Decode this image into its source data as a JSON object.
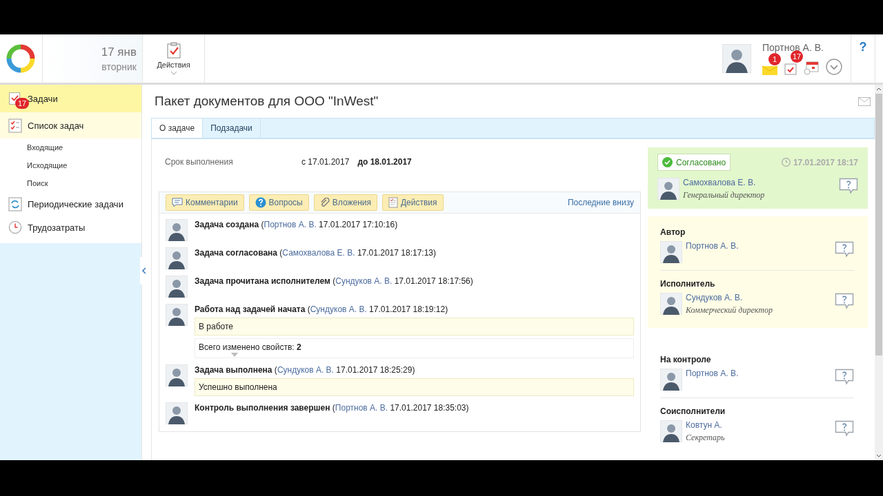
{
  "header": {
    "date": "17 янв",
    "weekday": "вторник",
    "actions_label": "Действия",
    "user_name": "Портнов А. В.",
    "mail_badge": "1",
    "tasks_badge": "17",
    "help": "?"
  },
  "sidebar": {
    "items": [
      {
        "label": "Задачи",
        "selected": true,
        "badge": "17"
      },
      {
        "label": "Список задач",
        "selected": false,
        "expanded": true,
        "children": [
          {
            "label": "Входящие"
          },
          {
            "label": "Исходящие"
          },
          {
            "label": "Поиск"
          }
        ]
      },
      {
        "label": "Периодические задачи",
        "selected": false
      },
      {
        "label": "Трудозатраты",
        "selected": false
      }
    ]
  },
  "task": {
    "title": "Пакет документов для ООО \"InWest\"",
    "tabs": [
      {
        "label": "О задаче",
        "selected": true
      },
      {
        "label": "Подзадачи",
        "selected": false
      }
    ],
    "deadline": {
      "label": "Срок выполнения",
      "from": "с 17.01.2017",
      "to": "до 18.01.2017"
    },
    "feed": {
      "filters": [
        {
          "kind": "comments",
          "label": "Комментарии"
        },
        {
          "kind": "questions",
          "label": "Вопросы"
        },
        {
          "kind": "attachments",
          "label": "Вложения"
        },
        {
          "kind": "actions",
          "label": "Действия"
        }
      ],
      "order_link": "Последние внизу",
      "events": [
        {
          "title": "Задача создана",
          "open": "(",
          "author": "Портнов А. В.",
          "time": "17.01.2017 17:10:16)"
        },
        {
          "title": "Задача согласована",
          "open": "(",
          "author": "Самохвалова Е. В.",
          "time": "17.01.2017 18:17:13)"
        },
        {
          "title": "Задача прочитана исполнителем",
          "open": "(",
          "author": "Сундуков А. В.",
          "time": "17.01.2017 18:17:56)"
        },
        {
          "title": "Работа над задачей начата",
          "open": "(",
          "author": "Сундуков А. В.",
          "time": "17.01.2017 18:19:12)",
          "note": "В работе",
          "summary": "Всего изменено свойств: **2**"
        },
        {
          "title": "Задача выполнена",
          "open": "(",
          "author": "Сундуков А. В.",
          "time": "17.01.2017 18:25:29)",
          "note": "Успешно выполнена"
        },
        {
          "title": "Контроль выполнения завершен",
          "open": "(",
          "author": "Портнов А. В.",
          "time": "17.01.2017 18:35:03)"
        }
      ]
    }
  },
  "approval": {
    "status": "Согласовано",
    "time": "17.01.2017 18:17",
    "name": "Самохвалова Е. В.",
    "role": "Генеральный директор"
  },
  "participant_groups": [
    {
      "highlighted": true,
      "sections": [
        {
          "heading": "Автор",
          "name": "Портнов А. В."
        },
        {
          "heading": "Исполнитель",
          "name": "Сундуков А. В.",
          "role": "Коммерческий директор"
        }
      ]
    },
    {
      "highlighted": false,
      "sections": [
        {
          "heading": "На контроле",
          "name": "Портнов А. В."
        },
        {
          "heading": "Соисполнители",
          "name": "Ковтун А.",
          "role": "Секретарь"
        }
      ]
    }
  ]
}
